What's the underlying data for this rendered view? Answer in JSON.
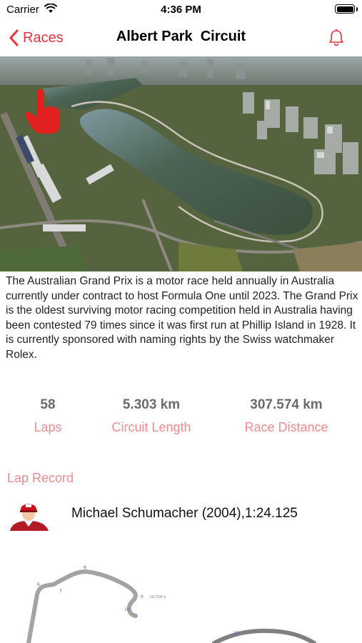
{
  "status_bar": {
    "carrier": "Carrier",
    "time": "4:36 PM"
  },
  "nav": {
    "back_label": "Races",
    "title": "Albert Park  Circuit"
  },
  "description": "The Australian Grand Prix is a motor race held annually in Australia currently under contract to host Formula One until 2023. The Grand Prix is the oldest surviving motor racing competition held in Australia having been contested 79 times since it was first run at Phillip Island in 1928. It is currently sponsored with naming rights by the Swiss watchmaker Rolex.",
  "stats": [
    {
      "value": "58",
      "label": "Laps"
    },
    {
      "value": "5.303 km",
      "label": "Circuit Length"
    },
    {
      "value": "307.574 km",
      "label": "Race Distance"
    }
  ],
  "lap_record": {
    "label": "Lap Record",
    "value": "Michael Schumacher (2004),1:24.125"
  },
  "track_map": {
    "turn_labels": [
      "6",
      "7",
      "8",
      "9",
      "10",
      "12"
    ],
    "sector_label": "SECTOR 2"
  },
  "colors": {
    "accent": "#e8323c",
    "label": "#f08a8e",
    "stat_value": "#6b6b6b"
  },
  "icons": [
    "wifi-icon",
    "battery-icon",
    "chevron-left-icon",
    "bell-icon",
    "hand-pointer-icon"
  ]
}
